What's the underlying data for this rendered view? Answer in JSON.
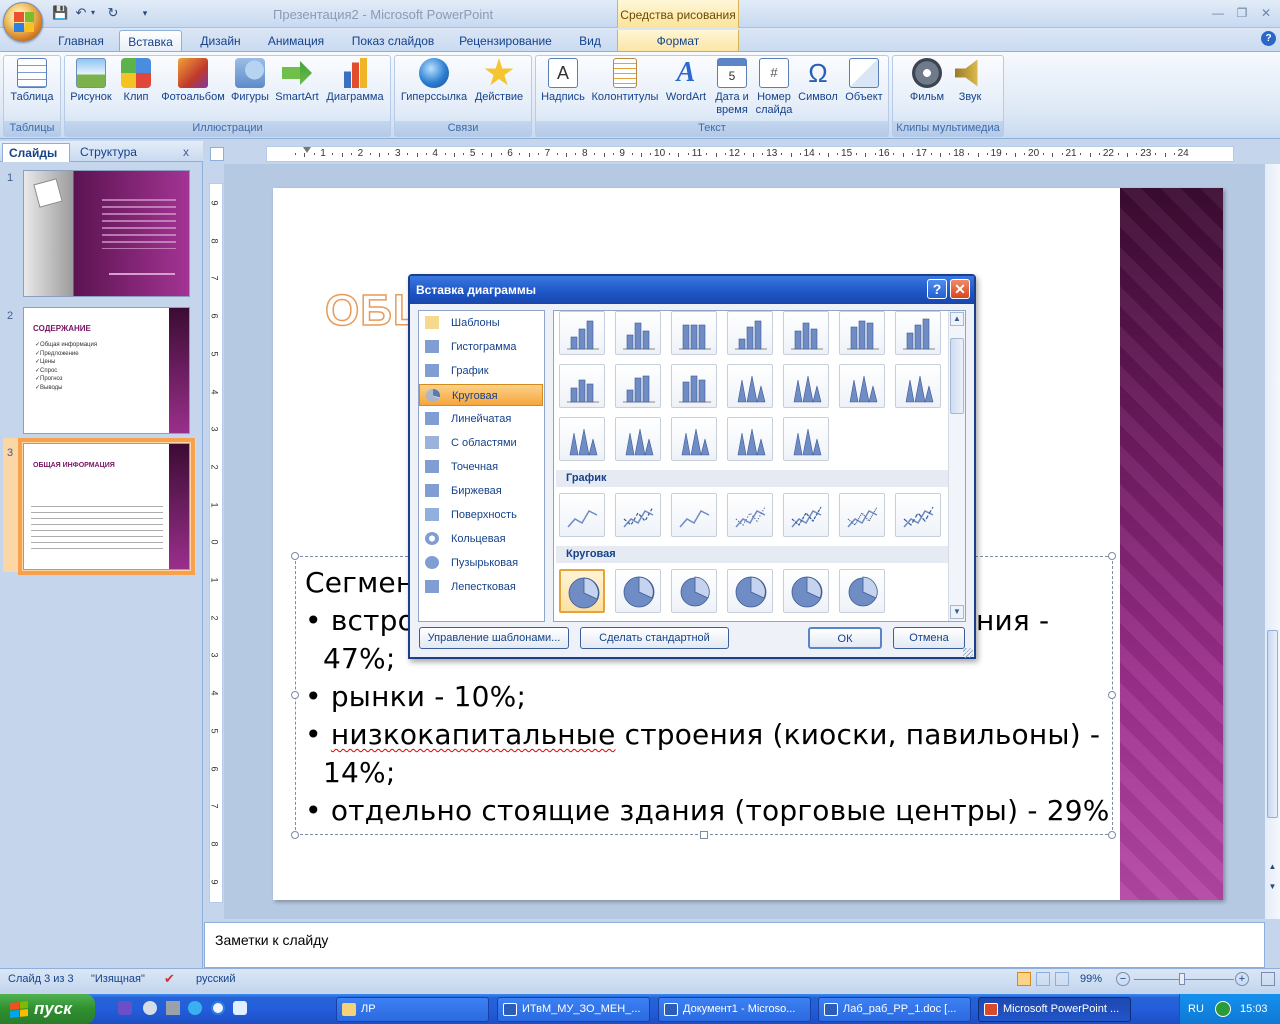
{
  "window": {
    "title": "Презентация2 - Microsoft PowerPoint",
    "contextual_header": "Средства рисования"
  },
  "tabs": [
    {
      "label": "Главная"
    },
    {
      "label": "Вставка"
    },
    {
      "label": "Дизайн"
    },
    {
      "label": "Анимация"
    },
    {
      "label": "Показ слайдов"
    },
    {
      "label": "Рецензирование"
    },
    {
      "label": "Вид"
    },
    {
      "label": "Формат"
    }
  ],
  "ribbon": {
    "groups": [
      {
        "name": "Таблицы"
      },
      {
        "name": "Иллюстрации"
      },
      {
        "name": "Связи"
      },
      {
        "name": "Текст"
      },
      {
        "name": "Клипы мультимедиа"
      }
    ],
    "buttons": {
      "table": "Таблица",
      "picture": "Рисунок",
      "clip": "Клип",
      "album": "Фотоальбом",
      "shapes": "Фигуры",
      "smartart": "SmartArt",
      "chart": "Диаграмма",
      "hyperlink": "Гиперссылка",
      "action": "Действие",
      "textbox": "Надпись",
      "headerfooter": "Колонтитулы",
      "wordart": "WordArt",
      "datetime_1": "Дата и",
      "datetime_2": "время",
      "slidenum_1": "Номер",
      "slidenum_2": "слайда",
      "symbol": "Символ",
      "object": "Объект",
      "movie": "Фильм",
      "sound": "Звук"
    }
  },
  "left_panel": {
    "tab_slides": "Слайды",
    "tab_outline": "Структура",
    "close": "x",
    "thumb_numbers": [
      "1",
      "2",
      "3"
    ],
    "thumb2_title": "СОДЕРЖАНИЕ",
    "thumb2_items": [
      "✓Общая информация",
      "✓Предложение",
      "✓Цены",
      "✓Спрос",
      "✓Прогноз",
      "✓Выводы"
    ],
    "thumb3_title": "ОБЩАЯ ИНФОРМАЦИЯ"
  },
  "ruler": {
    "h_numbers": [
      "1",
      "2",
      "3",
      "4",
      "5",
      "6",
      "7",
      "8",
      "9",
      "10",
      "11",
      "12",
      "13",
      "14",
      "15",
      "16",
      "17",
      "18",
      "19",
      "20",
      "21",
      "22",
      "23",
      "24"
    ],
    "v_numbers": [
      "9",
      "8",
      "7",
      "6",
      "5",
      "4",
      "3",
      "2",
      "1",
      "0",
      "1",
      "2",
      "3",
      "4",
      "5",
      "6",
      "7",
      "8",
      "9"
    ]
  },
  "slide": {
    "title_partial": "ОБЩ",
    "line1": "Сегмен",
    "line2a": "• встро",
    "line2b": "ния -",
    "line3": "47%;",
    "line4": "• рынки - 10%;",
    "line5a": "• ",
    "line5b": "низкокапитальные",
    "line5c": " строения (киоски, павильоны) -",
    "line6": "14%;",
    "line7": "• отдельно стоящие здания (торговые центры) - 29%"
  },
  "dialog": {
    "title": "Вставка диаграммы",
    "help": "?",
    "close": "✕",
    "categories": [
      {
        "label": "Шаблоны",
        "icon": "folder-icon"
      },
      {
        "label": "Гистограмма",
        "icon": "column-chart-icon"
      },
      {
        "label": "График",
        "icon": "line-chart-icon"
      },
      {
        "label": "Круговая",
        "icon": "pie-chart-icon"
      },
      {
        "label": "Линейчатая",
        "icon": "bar-chart-icon"
      },
      {
        "label": "С областями",
        "icon": "area-chart-icon"
      },
      {
        "label": "Точечная",
        "icon": "scatter-chart-icon"
      },
      {
        "label": "Биржевая",
        "icon": "stock-chart-icon"
      },
      {
        "label": "Поверхность",
        "icon": "surface-chart-icon"
      },
      {
        "label": "Кольцевая",
        "icon": "doughnut-chart-icon"
      },
      {
        "label": "Пузырьковая",
        "icon": "bubble-chart-icon"
      },
      {
        "label": "Лепестковая",
        "icon": "radar-chart-icon"
      }
    ],
    "selected_category": "Круговая",
    "section_line": "График",
    "section_pie": "Круговая",
    "btn_manage": "Управление шаблонами...",
    "btn_default": "Сделать стандартной",
    "btn_ok": "ОК",
    "btn_cancel": "Отмена"
  },
  "notes": {
    "placeholder": "Заметки к слайду"
  },
  "status": {
    "slide": "Слайд 3 из 3",
    "theme": "\"Изящная\"",
    "lang": "русский",
    "zoom": "99%"
  },
  "taskbar": {
    "start": "пуск",
    "items": [
      "ЛР",
      "ИТвМ_МУ_ЗО_МЕН_...",
      "Документ1 - Microso...",
      "Лаб_раб_PP_1.doc [...",
      "Microsoft PowerPoint ..."
    ],
    "lang": "RU",
    "time": "15:03"
  },
  "colors": {
    "accent": "#f6a53c",
    "slide_strip": "#9d2f8d",
    "title_outline": "#e89b57"
  }
}
